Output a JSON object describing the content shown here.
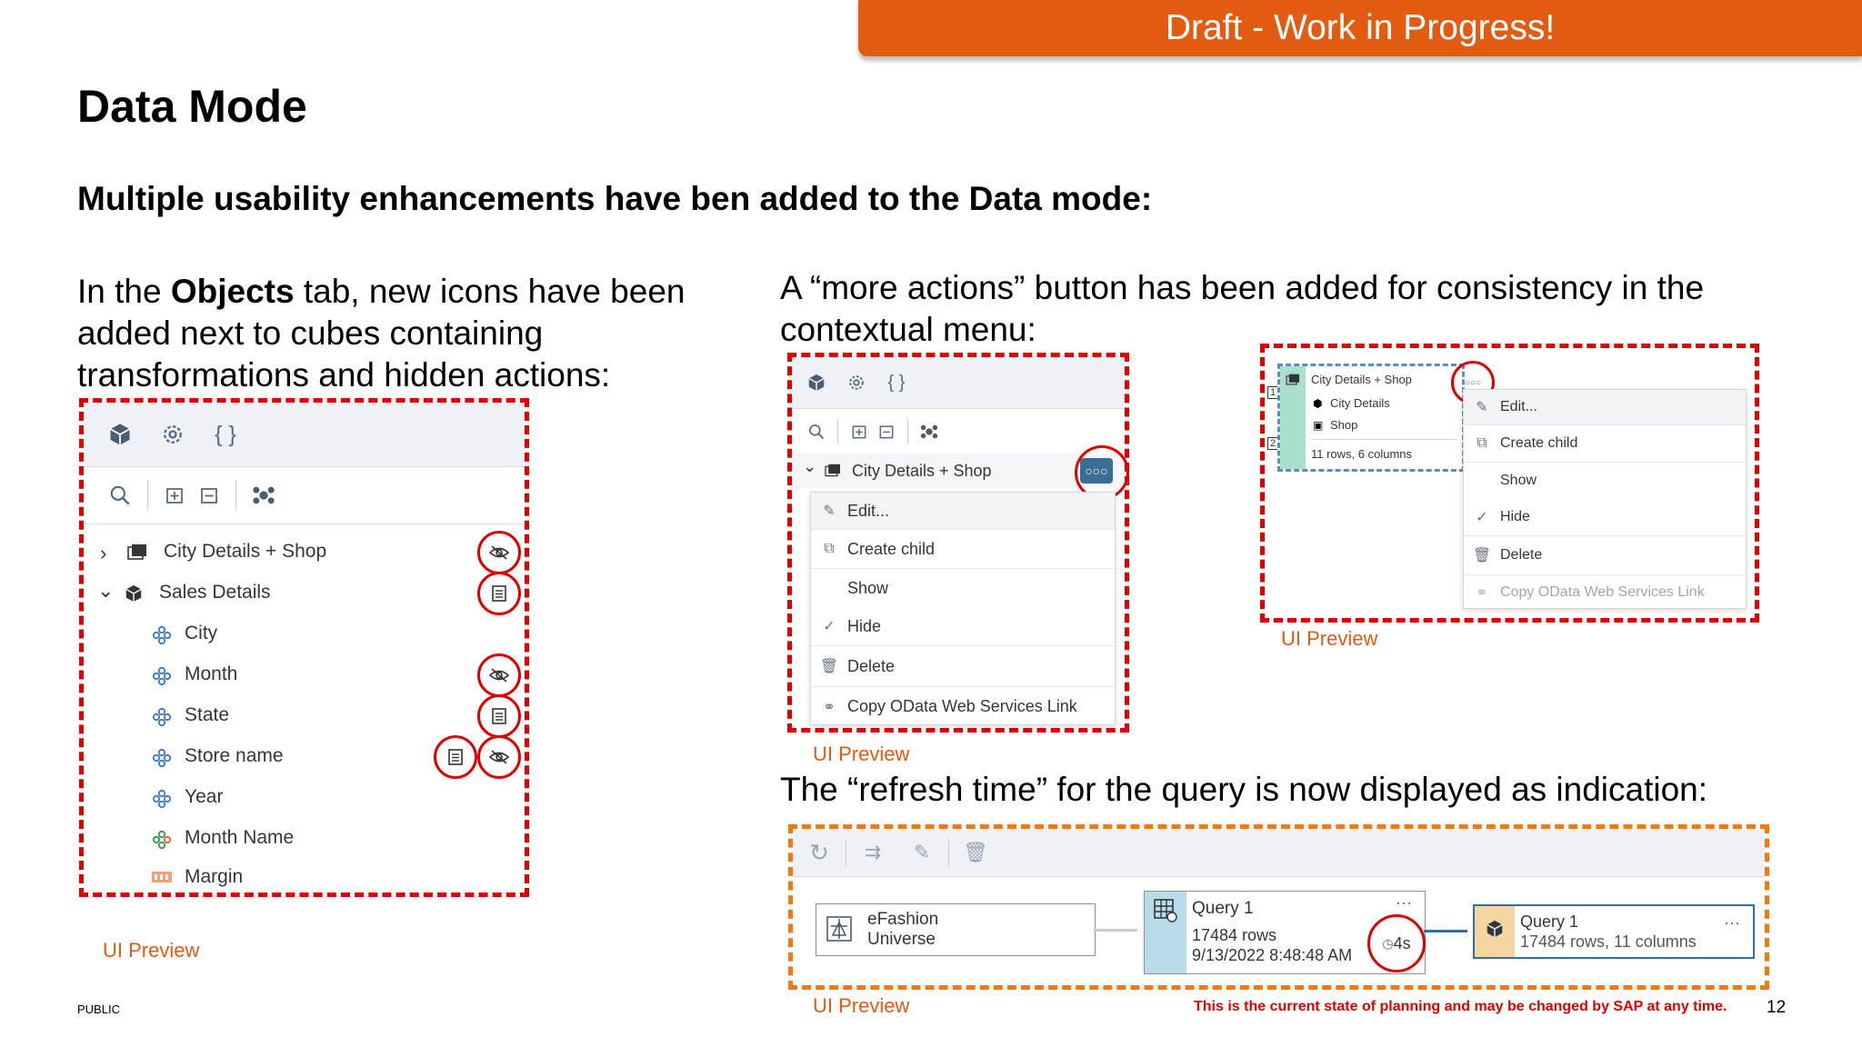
{
  "banner": {
    "text": "Draft - Work in Progress!"
  },
  "title": "Data Mode",
  "subtitle": "Multiple usability enhancements have ben added to the Data mode:",
  "left_text": {
    "part1": "In the ",
    "bold": "Objects",
    "part2": " tab, new icons have been added next to cubes containing transformations and hidden actions:"
  },
  "middle_text": "A “more actions” button has been added for consistency in the contextual menu:",
  "bottom_text": "The “refresh time” for the query is now displayed as indication:",
  "preview_label": "UI Preview",
  "footer": {
    "public": "PUBLIC",
    "disclaimer": "This is the current state of planning and may be changed by SAP at any time.",
    "page": "12"
  },
  "objects_panel": {
    "tabs": [
      "cube-icon",
      "gear-icon",
      "braces-icon"
    ],
    "tools": [
      "search-icon",
      "expand-all-icon",
      "collapse-all-icon",
      "hierarchy-icon"
    ],
    "items": [
      {
        "label": "City Details + Shop",
        "type": "cube",
        "expanded": false,
        "indicators": [
          "hidden-icon"
        ]
      },
      {
        "label": "Sales Details",
        "type": "cube",
        "expanded": true,
        "indicators": [
          "transformation-icon"
        ]
      },
      {
        "label": "City",
        "type": "dimension",
        "indicators": []
      },
      {
        "label": "Month",
        "type": "dimension",
        "indicators": [
          "hidden-icon"
        ]
      },
      {
        "label": "State",
        "type": "dimension",
        "indicators": [
          "transformation-icon"
        ]
      },
      {
        "label": "Store name",
        "type": "dimension",
        "indicators": [
          "transformation-icon",
          "hidden-icon"
        ]
      },
      {
        "label": "Year",
        "type": "dimension",
        "indicators": []
      },
      {
        "label": "Month Name",
        "type": "calculated-dimension",
        "indicators": []
      },
      {
        "label": "Margin",
        "type": "measure",
        "indicators": []
      }
    ]
  },
  "context_menu": {
    "tree_item": "City Details + Shop",
    "items": [
      {
        "label": "Edit...",
        "icon": "pencil-icon"
      },
      {
        "label": "Create child",
        "icon": "create-child-icon"
      },
      {
        "label": "Show",
        "icon": ""
      },
      {
        "label": "Hide",
        "icon": "checkmark-icon"
      },
      {
        "label": "Delete",
        "icon": "trash-icon"
      },
      {
        "label": "Copy OData Web Services Link",
        "icon": "link-icon"
      }
    ]
  },
  "context_menu_small": {
    "node_title": "City Details + Shop",
    "node_rows": [
      "City Details",
      "Shop"
    ],
    "node_info": "11 rows, 6 columns",
    "row_markers": [
      "1",
      "2"
    ],
    "items": [
      {
        "label": "Edit...",
        "disabled": false
      },
      {
        "label": "Create child",
        "disabled": false
      },
      {
        "label": "Show",
        "disabled": false
      },
      {
        "label": "Hide",
        "disabled": false
      },
      {
        "label": "Delete",
        "disabled": false
      },
      {
        "label": "Copy OData Web Services Link",
        "disabled": true
      }
    ]
  },
  "flow": {
    "toolbar": [
      "refresh-icon",
      "shuffle-icon",
      "pencil-icon",
      "trash-icon"
    ],
    "universe": {
      "line1": "eFashion",
      "line2": "Universe"
    },
    "query": {
      "title": "Query 1",
      "rows": "17484 rows",
      "timestamp": "9/13/2022 8:48:48 AM",
      "refresh_time": "4s",
      "more": "···"
    },
    "result": {
      "title": "Query 1",
      "info": "17484 rows, 11 columns",
      "more": "···"
    }
  }
}
